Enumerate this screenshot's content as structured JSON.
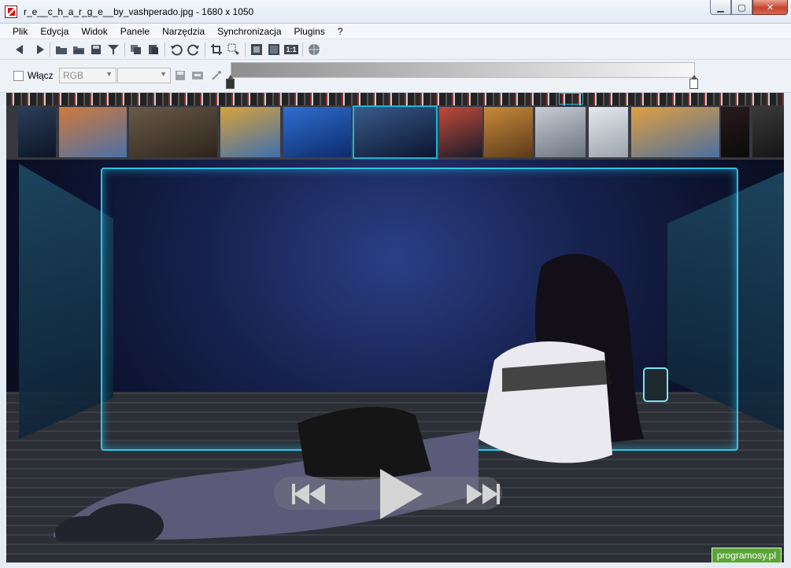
{
  "window": {
    "title": "r_e__c_h_a_r_g_e__by_vashperado.jpg  - 1680 x 1050",
    "buttons": {
      "minimize": "▁",
      "maximize": "▢",
      "close": "✕"
    }
  },
  "menu": [
    {
      "id": "plik",
      "label": "Plik"
    },
    {
      "id": "edycja",
      "label": "Edycja"
    },
    {
      "id": "widok",
      "label": "Widok"
    },
    {
      "id": "panele",
      "label": "Panele"
    },
    {
      "id": "narzedzia",
      "label": "Narzędzia"
    },
    {
      "id": "synchronizacja",
      "label": "Synchronizacja"
    },
    {
      "id": "plugins",
      "label": "Plugins"
    },
    {
      "id": "help",
      "label": "?"
    }
  ],
  "toolbar": {
    "icons": [
      "back-arrow-icon",
      "forward-arrow-icon",
      "open-folder-icon",
      "folder-icon",
      "save-icon",
      "filter-icon",
      "copy-icon",
      "paste-icon",
      "rotate-left-icon",
      "rotate-right-icon",
      "crop-icon",
      "zoom-select-icon",
      "fit-window-icon",
      "fullscreen-icon",
      "actual-size-icon",
      "globe-icon"
    ],
    "actual_size_label": "1:1"
  },
  "adjust": {
    "enable_label": "Włącz",
    "enabled": false,
    "channel_value": "RGB",
    "second_value": "",
    "gradient_from": "#8e8e8e",
    "gradient_to": "#f7f7f7"
  },
  "thumbnails": [
    {
      "name": "thumb-space-creature",
      "c1": "#2b3e5a",
      "c2": "#0c1424"
    },
    {
      "name": "thumb-canyon",
      "c1": "#d07a3a",
      "c2": "#4b70a8"
    },
    {
      "name": "thumb-ruins",
      "c1": "#6a5a48",
      "c2": "#2c241c"
    },
    {
      "name": "thumb-arches",
      "c1": "#d8a23a",
      "c2": "#3d6fb0"
    },
    {
      "name": "thumb-puzzle",
      "c1": "#2f6fd0",
      "c2": "#0d2a6a"
    },
    {
      "name": "thumb-recharge",
      "c1": "#3a5a8a",
      "c2": "#0a1530",
      "selected": true
    },
    {
      "name": "thumb-city-tower",
      "c1": "#c04a3a",
      "c2": "#1a1a2a"
    },
    {
      "name": "thumb-dragon",
      "c1": "#c88a3a",
      "c2": "#5a3a1a"
    },
    {
      "name": "thumb-airship",
      "c1": "#c8ccd4",
      "c2": "#6a7380"
    },
    {
      "name": "thumb-snow-scene",
      "c1": "#e4e8ec",
      "c2": "#9aa3ad"
    },
    {
      "name": "thumb-castle",
      "c1": "#e0a040",
      "c2": "#4a6fa0"
    },
    {
      "name": "thumb-dark-dragon",
      "c1": "#2a1a1a",
      "c2": "#0a0a0a"
    },
    {
      "name": "thumb-dark-extra",
      "c1": "#3a3a3a",
      "c2": "#151515"
    }
  ],
  "player": {
    "prev_icon": "rewind-icon",
    "play_icon": "play-icon",
    "next_icon": "fast-forward-icon"
  },
  "watermark": "programosy.pl"
}
